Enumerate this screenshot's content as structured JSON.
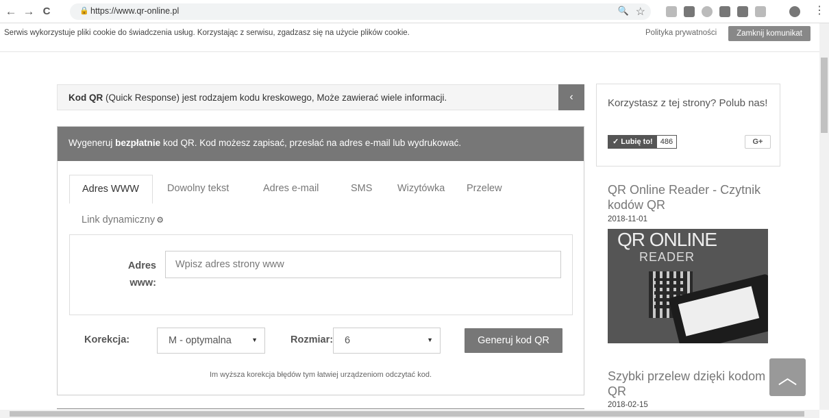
{
  "browser": {
    "url": "https://www.qr-online.pl",
    "back_icon": "←",
    "forward_icon": "→",
    "reload_icon": "C",
    "lock_icon": "🔒",
    "zoom_icon": "🔍",
    "star_icon": "☆",
    "menu_icon": "⋮"
  },
  "cookie_bar": {
    "text": "Serwis wykorzystuje pliki cookie do świadczenia usług. Korzystając z serwisu, zgadzasz się na użycie plików cookie.",
    "privacy_link": "Polityka prywatności",
    "close_button": "Zamknij komunikat"
  },
  "info_bar": {
    "bold": "Kod QR",
    "text": " (Quick Response) jest rodzajem kodu kreskowego, Może zawierać wiele informacji.",
    "collapse_icon": "‹"
  },
  "panel": {
    "header_before": "Wygeneruj ",
    "header_bold": "bezpłatnie",
    "header_after": " kod QR. Kod możesz zapisać, przesłać na adres e-mail lub wydrukować.",
    "tabs": [
      {
        "label": "Adres WWW"
      },
      {
        "label": "Dowolny tekst"
      },
      {
        "label": "Adres e-mail"
      },
      {
        "label": "SMS"
      },
      {
        "label": "Wizytówka"
      },
      {
        "label": "Przelew"
      },
      {
        "label": "Link dynamiczny"
      }
    ],
    "dynamic_icon": "⚙",
    "form": {
      "label_line1": "Adres",
      "label_line2": "www:",
      "placeholder": "Wpisz adres strony www",
      "value": ""
    },
    "correction_label": "Korekcja:",
    "correction_value": "M - optymalna",
    "size_label": "Rozmiar:",
    "size_value": "6",
    "select_arrow": "▼",
    "generate_button": "Generuj kod QR",
    "hint": "Im wyższa korekcja błędów tym łatwiej urządzeniom odczytać kod."
  },
  "sidebar": {
    "like_text": "Korzystasz z tej strony? Polub nas!",
    "fb_like_label": "✓ Lubię to!",
    "fb_count": "486",
    "gplus_label": "G+",
    "articles": [
      {
        "title": "QR Online Reader - Czytnik kodów QR",
        "date": "2018-11-01",
        "thumb_title": "QR ONLINE",
        "thumb_sub": "READER"
      },
      {
        "title": "Szybki przelew dzięki kodom QR",
        "date": "2018-02-15"
      }
    ],
    "scroll_top_icon": "︿"
  },
  "colors": {
    "accent_gray": "#777777",
    "panel_border": "#cccccc"
  }
}
